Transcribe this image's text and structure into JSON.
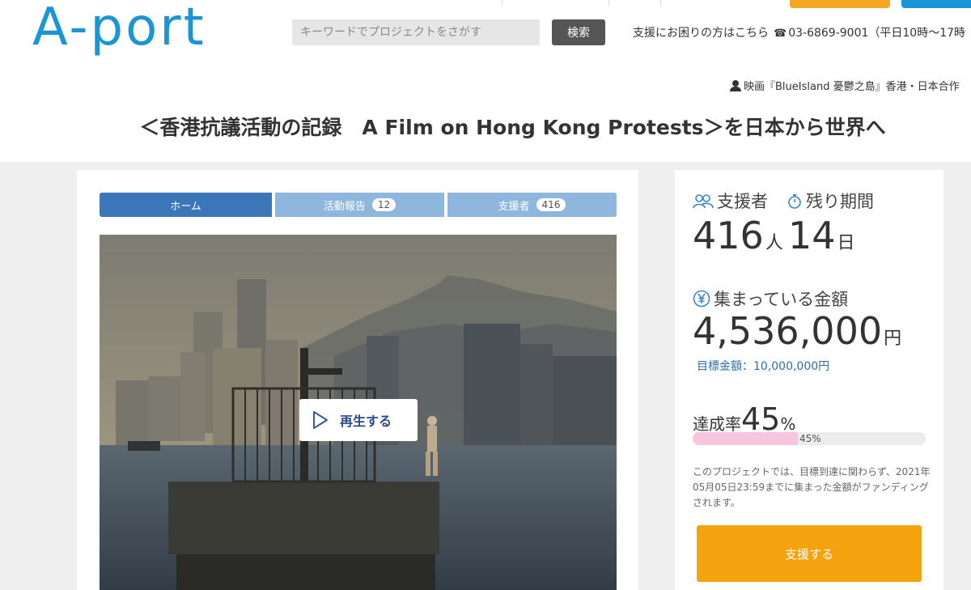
{
  "header": {
    "logo": "A-port",
    "search_placeholder": "キーワードでプロジェクトをさがす",
    "search_button": "検索",
    "help_text": "支援にお困りの方はこちら",
    "help_phone": "03-6869-9001（平日10時〜17時",
    "phone_icon": "☎"
  },
  "project": {
    "owner": "映画『BlueIsland 憂鬱之島』香港・日本合作",
    "title": "＜香港抗議活動の記録　A Film on Hong Kong Protests＞を日本から世界へ"
  },
  "tabs": [
    {
      "label": "ホーム",
      "count": null,
      "active": true
    },
    {
      "label": "活動報告",
      "count": "12",
      "active": false
    },
    {
      "label": "支援者",
      "count": "416",
      "active": false
    }
  ],
  "video": {
    "play_label": "再生する"
  },
  "stats": {
    "supporters_label": "支援者",
    "supporters_value": "416",
    "supporters_unit": "人",
    "remaining_label": "残り期間",
    "remaining_value": "14",
    "remaining_unit": "日",
    "amount_label": "集まっている金額",
    "amount_value": "4,536,000",
    "amount_unit": "円",
    "goal_text": "目標金額：10,000,000円",
    "rate_label": "達成率",
    "rate_value": "45",
    "rate_unit": "%",
    "progress_label": "45%",
    "progress_fraction": 0.45,
    "note": "このプロジェクトでは、目標到達に関わらず、2021年05月05日23:59までに集まった金額がファンディングされます。",
    "back_button": "支援する"
  },
  "colors": {
    "brand": "#1a96d4",
    "tab_active": "#3a76b8",
    "tab_inactive": "#8fb7dd",
    "cta": "#f5a20f",
    "progress": "#f7c6de"
  }
}
